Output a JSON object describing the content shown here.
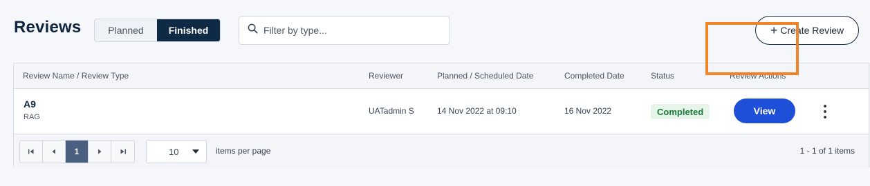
{
  "header": {
    "title": "Reviews",
    "toggle": {
      "planned": "Planned",
      "finished": "Finished",
      "selected": "Finished"
    },
    "filter_placeholder": "Filter by type...",
    "create_button": "Create Review",
    "create_icon": "+"
  },
  "table": {
    "columns": [
      "Review Name / Review Type",
      "Reviewer",
      "Planned / Scheduled Date",
      "Completed Date",
      "Status",
      "Review Actions"
    ],
    "rows": [
      {
        "name": "A9",
        "type": "RAG",
        "reviewer": "UATadmin S",
        "planned_date": "14 Nov 2022 at 09:10",
        "completed_date": "16 Nov 2022",
        "status": "Completed",
        "action": "View"
      }
    ]
  },
  "pagination": {
    "current_page": "1",
    "page_size": "10",
    "items_per_page_label": "items per page",
    "info": "1 - 1 of 1 items"
  },
  "colors": {
    "brand_dark": "#0f2a44",
    "primary": "#1e4fd8",
    "status_completed_bg": "#e6f4ea",
    "status_completed_text": "#1e7a3c",
    "highlight": "#f08427"
  }
}
